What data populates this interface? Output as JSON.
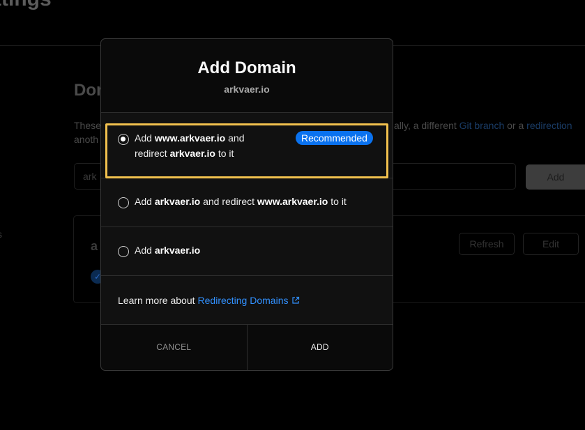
{
  "background": {
    "page_title": "ttings",
    "section_title": "Dor",
    "description_line1_start": "These",
    "description_line1_end": "ally, a different",
    "description_link1": "Git branch",
    "description_or": "or a",
    "description_link2": "redirection",
    "description_line2": "anoth",
    "domain_input_value": "ark",
    "add_button": "Add",
    "card_title": "a",
    "refresh_button": "Refresh",
    "edit_button": "Edit",
    "side_mark": "s"
  },
  "modal": {
    "title": "Add Domain",
    "subtitle": "arkvaer.io",
    "options": [
      {
        "line1_a": "Add ",
        "line1_b": "www.arkvaer.io",
        "line1_c": " and",
        "line2_a": "redirect ",
        "line2_b": "arkvaer.io",
        "line2_c": " to it",
        "badge": "Recommended",
        "selected": true
      },
      {
        "a": "Add ",
        "b": "arkvaer.io",
        "c": " and redirect ",
        "d": "www.arkvaer.io",
        "e": " to it",
        "selected": false
      },
      {
        "a": "Add ",
        "b": "arkvaer.io",
        "selected": false
      }
    ],
    "learn_more_text": "Learn more about",
    "learn_more_link": "Redirecting Domains",
    "cancel_label": "CANCEL",
    "add_label": "ADD"
  },
  "colors": {
    "accent_blue": "#0a72ef",
    "link_blue": "#3291ff",
    "highlight_yellow": "#f2c14e"
  }
}
